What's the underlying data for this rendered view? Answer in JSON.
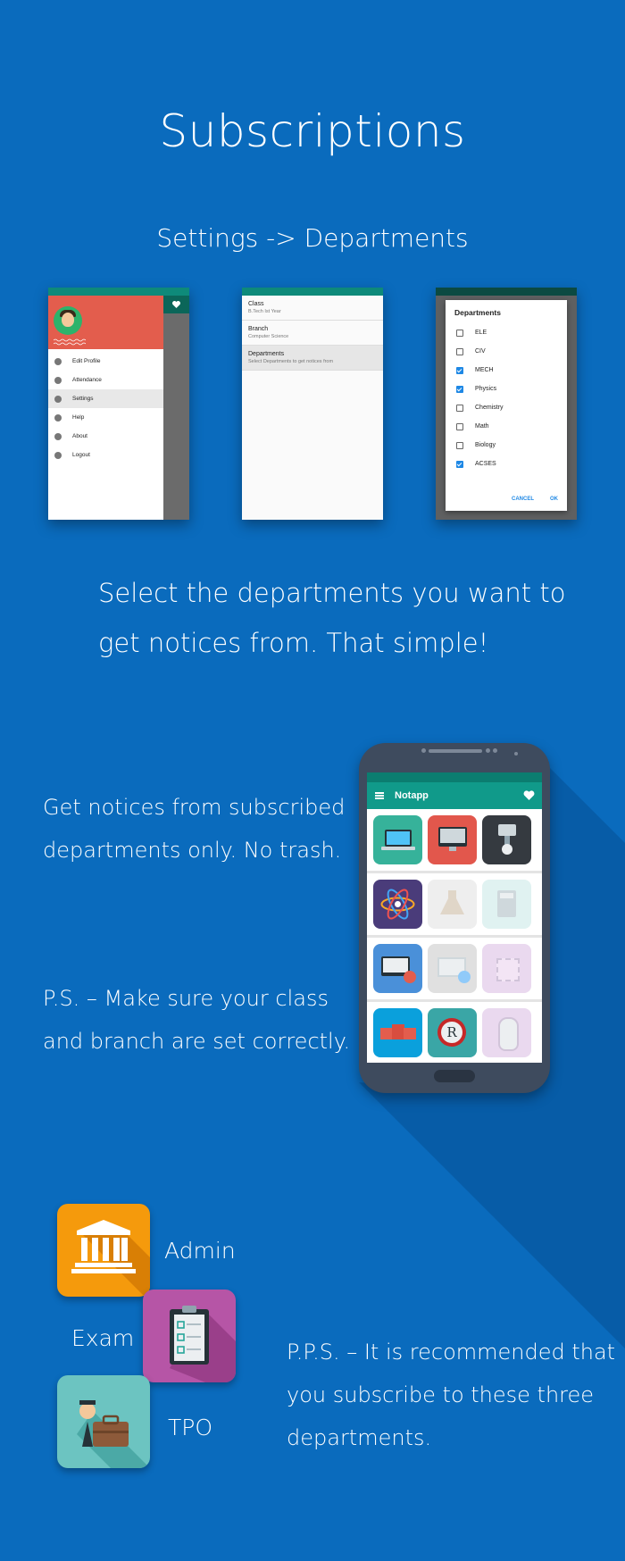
{
  "page": {
    "title": "Subscriptions",
    "subtitle": "Settings -> Departments",
    "description_line1": "Select the departments you want to",
    "description_line2": "get notices from. That simple!",
    "notice_line1": "Get notices from subscribed",
    "notice_line2": "departments only. No trash.",
    "ps_line1": "P.S. – Make sure your class",
    "ps_line2": "and branch are set correctly.",
    "pps_line1": "P.P.S. – It is recommended that",
    "pps_line2": "you subscribe to these three",
    "pps_line3": "departments."
  },
  "drawer": {
    "items": [
      {
        "label": "Edit Profile",
        "icon": "account-circle-icon"
      },
      {
        "label": "Attendance",
        "icon": "people-icon"
      },
      {
        "label": "Settings",
        "icon": "gear-icon",
        "active": true
      },
      {
        "label": "Help",
        "icon": "help-icon"
      },
      {
        "label": "About",
        "icon": "info-icon"
      },
      {
        "label": "Logout",
        "icon": "power-icon"
      }
    ]
  },
  "settings": {
    "rows": [
      {
        "title": "Class",
        "sub": "B.Tech Ist Year"
      },
      {
        "title": "Branch",
        "sub": "Computer Science"
      },
      {
        "title": "Departments",
        "sub": "Select Departments to get notices from"
      }
    ]
  },
  "dialog": {
    "title": "Departments",
    "items": [
      {
        "label": "ELE",
        "checked": false
      },
      {
        "label": "CIV",
        "checked": false
      },
      {
        "label": "MECH",
        "checked": true
      },
      {
        "label": "Physics",
        "checked": true
      },
      {
        "label": "Chemistry",
        "checked": false
      },
      {
        "label": "Math",
        "checked": false
      },
      {
        "label": "Biology",
        "checked": false
      },
      {
        "label": "ACSES",
        "checked": true
      }
    ],
    "cancel": "CANCEL",
    "ok": "OK"
  },
  "app": {
    "name": "Notapp"
  },
  "departments": {
    "admin": "Admin",
    "exam": "Exam",
    "tpo": "TPO"
  },
  "colors": {
    "background": "#0a6bbd",
    "teal": "#109a8a",
    "drawer_header": "#e35d4d",
    "admin": "#f59a0c",
    "exam": "#b655a6",
    "tpo": "#6cc4c1"
  }
}
